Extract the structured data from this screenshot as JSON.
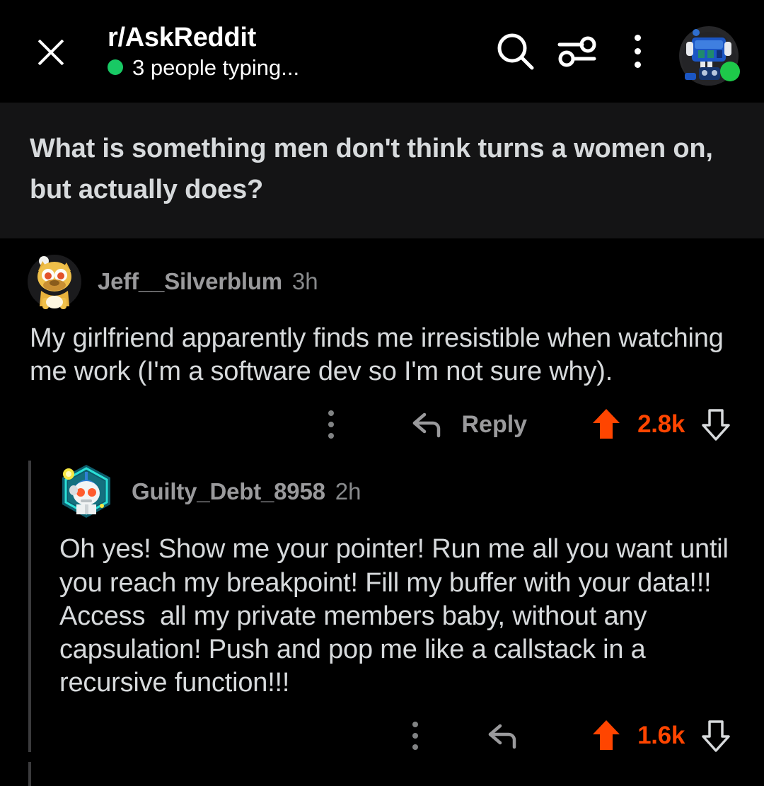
{
  "header": {
    "close_icon": "close-icon",
    "subreddit": "r/AskReddit",
    "typing_status": "3 people typing...",
    "search_icon": "search-icon",
    "sort_icon": "sort-filter-icon",
    "overflow_icon": "kebab-menu-icon",
    "avatar_icon": "user-avatar",
    "online_status": "online"
  },
  "post": {
    "title": "What is something men don't think turns a women on, but actually does?"
  },
  "comments": [
    {
      "author": "Jeff__Silverblum",
      "time": "3h",
      "avatar": "dog-snoo-avatar",
      "body": "My girlfriend apparently finds me irresistible when watching me work (I'm a software dev so I'm not sure why).",
      "overflow_label": "kebab-menu-icon",
      "reply_label": "Reply",
      "score": "2.8k",
      "upvoted": true
    },
    {
      "author": "Guilty_Debt_8958",
      "time": "2h",
      "avatar": "hex-nft-snoo-avatar",
      "body": "Oh yes! Show me your pointer! Run me all you want until you reach my breakpoint! Fill my buffer with your data!!! Access  all my private members baby, without any capsulation! Push and pop me like a callstack in a recursive function!!!",
      "overflow_label": "kebab-menu-icon",
      "reply_label": "",
      "score": "1.6k",
      "upvoted": true
    }
  ],
  "colors": {
    "accent_orange": "#ff4500",
    "online_green": "#18c964",
    "background": "#000000",
    "post_band": "#141415",
    "text_primary": "#d7dadc",
    "text_muted": "#9a9a9c",
    "thread_line": "#3b3b3d"
  }
}
